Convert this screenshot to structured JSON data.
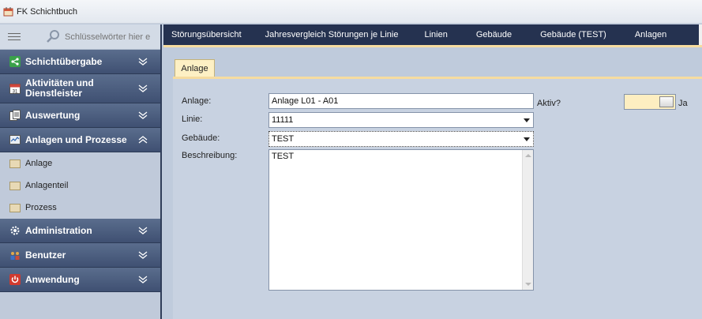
{
  "window": {
    "title": "FK Schichtbuch"
  },
  "sidebar": {
    "search_placeholder": "Schlüsselwörter hier e",
    "groups": [
      {
        "label": "Schichtübergabe",
        "icon": "share-icon",
        "state": "collapsed"
      },
      {
        "label": "Aktivitäten und Dienstleister",
        "icon": "calendar-icon",
        "state": "collapsed"
      },
      {
        "label": "Auswertung",
        "icon": "documents-icon",
        "state": "collapsed"
      },
      {
        "label": "Anlagen und Prozesse",
        "icon": "chart-icon",
        "state": "expanded"
      },
      {
        "label": "Administration",
        "icon": "gear-icon",
        "state": "collapsed"
      },
      {
        "label": "Benutzer",
        "icon": "users-icon",
        "state": "collapsed"
      },
      {
        "label": "Anwendung",
        "icon": "power-icon",
        "state": "collapsed"
      }
    ],
    "items": [
      {
        "label": "Anlage"
      },
      {
        "label": "Anlagenteil"
      },
      {
        "label": "Prozess"
      }
    ]
  },
  "tabs": [
    "Störungsübersicht",
    "Jahresvergleich Störungen je Linie",
    "Linien",
    "Gebäude",
    "Gebäude (TEST)",
    "Anlagen"
  ],
  "form": {
    "tab_label": "Anlage",
    "anlage_label": "Anlage:",
    "anlage_value": "Anlage L01 - A01",
    "linie_label": "Linie:",
    "linie_value": "11111",
    "gebaeude_label": "Gebäude:",
    "gebaeude_value": "TEST",
    "beschreibung_label": "Beschreibung:",
    "beschreibung_value": "TEST",
    "aktiv_label": "Aktiv?",
    "aktiv_value": "Ja"
  },
  "colors": {
    "nav_group": "#3f5072",
    "tab_bar": "#253250",
    "accent": "#f6dca0"
  }
}
